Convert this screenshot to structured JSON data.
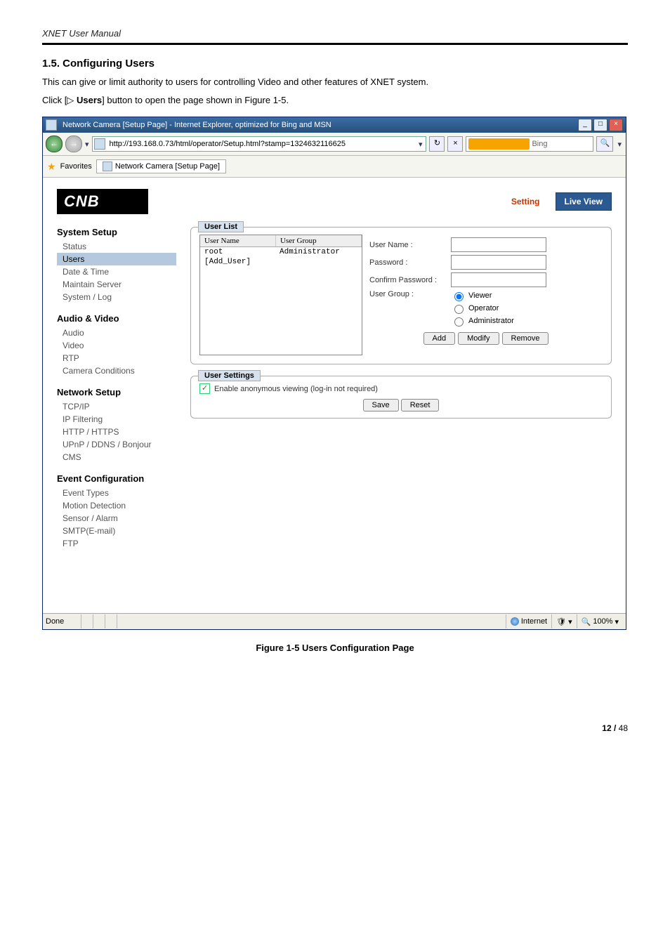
{
  "doc": {
    "header": "XNET User Manual",
    "section_title": "1.5. Configuring Users",
    "para1": "This can give or limit authority to users for controlling Video and other features of XNET system.",
    "para2_pre": "Click [",
    "para2_tri": "▷",
    "para2_users": " Users",
    "para2_post": "] button to open the page shown in Figure 1-5.",
    "figure_caption": "Figure 1-5 Users Configuration Page",
    "page_no_bold": "12 / ",
    "page_no_rest": "48"
  },
  "ie": {
    "title": "Network Camera [Setup Page] - Internet Explorer, optimized for Bing and MSN",
    "url": "http://193.168.0.73/html/operator/Setup.html?stamp=1324632116625",
    "search_placeholder": "Bing",
    "favorites_label": "Favorites",
    "tab_label": "Network Camera [Setup Page]",
    "status_done": "Done",
    "status_zone": "Internet",
    "status_zoom": "100%"
  },
  "ui": {
    "logo_a": "C",
    "logo_b": "N",
    "logo_c": "B",
    "link_setting": "Setting",
    "link_live": "Live View",
    "nav": {
      "g1": "System Setup",
      "g1_items": [
        "Status",
        "Users",
        "Date & Time",
        "Maintain Server",
        "System / Log"
      ],
      "g2": "Audio & Video",
      "g2_items": [
        "Audio",
        "Video",
        "RTP",
        "Camera Conditions"
      ],
      "g3": "Network Setup",
      "g3_items": [
        "TCP/IP",
        "IP Filtering",
        "HTTP / HTTPS",
        "UPnP / DDNS / Bonjour",
        "CMS"
      ],
      "g4": "Event Configuration",
      "g4_items": [
        "Event Types",
        "Motion Detection",
        "Sensor / Alarm",
        "SMTP(E-mail)",
        "FTP"
      ]
    },
    "userlist": {
      "legend": "User List",
      "col_name": "User Name",
      "col_group": "User Group",
      "rows": [
        {
          "name": "root",
          "group": "Administrator"
        },
        {
          "name": "[Add_User]",
          "group": ""
        }
      ]
    },
    "form": {
      "username_l": "User Name :",
      "password_l": "Password :",
      "confirm_l": "Confirm Password :",
      "group_l": "User Group :",
      "opt_viewer": "Viewer",
      "opt_operator": "Operator",
      "opt_admin": "Administrator",
      "btn_add": "Add",
      "btn_modify": "Modify",
      "btn_remove": "Remove"
    },
    "settings": {
      "legend": "User Settings",
      "anon": "Enable anonymous viewing (log-in not required)",
      "btn_save": "Save",
      "btn_reset": "Reset"
    }
  },
  "chart_data": {
    "type": "table",
    "title": "User List",
    "columns": [
      "User Name",
      "User Group"
    ],
    "rows": [
      [
        "root",
        "Administrator"
      ],
      [
        "[Add_User]",
        ""
      ]
    ]
  }
}
